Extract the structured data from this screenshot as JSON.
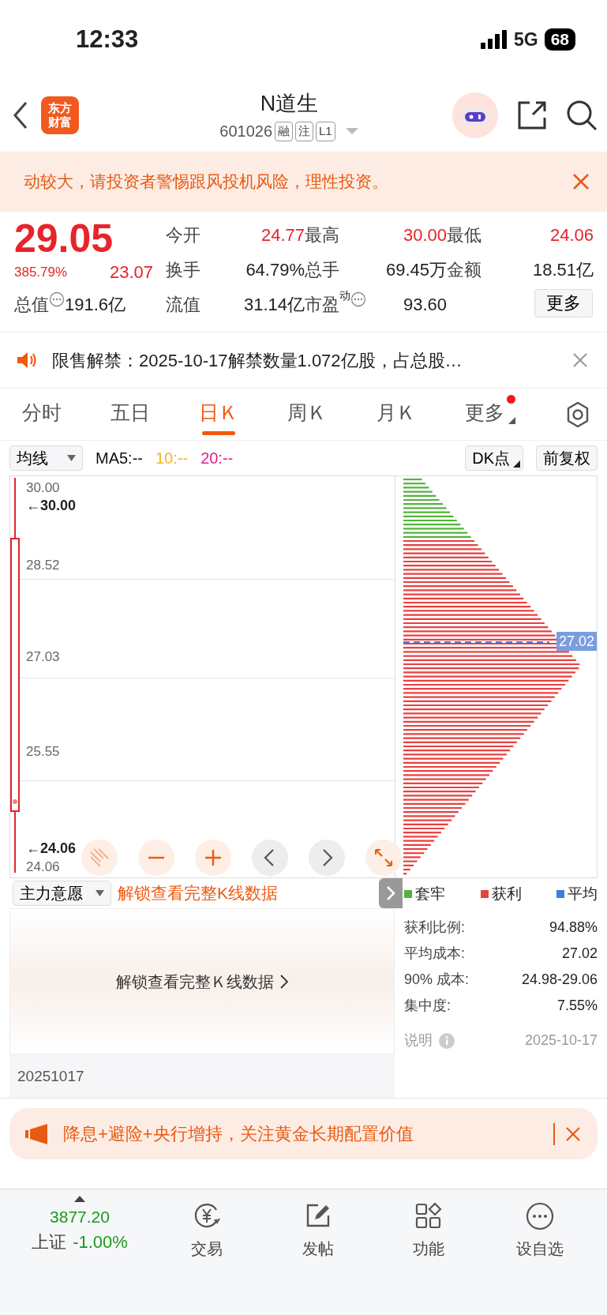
{
  "status_bar": {
    "time": "12:33",
    "network": "5G",
    "battery": "68"
  },
  "header": {
    "logo": "东方财富",
    "title": "N道生",
    "code": "601026",
    "tags": [
      "融",
      "注",
      "L1"
    ]
  },
  "warning": {
    "text": "动较大，请投资者警惕跟风投机风险，理性投资。"
  },
  "quote": {
    "price": "29.05",
    "change_pct": "385.79%",
    "change": "23.07",
    "fields": [
      {
        "label": "今开",
        "value": "24.77",
        "kind": "up",
        "info": false
      },
      {
        "label": "最高",
        "value": "30.00",
        "kind": "up",
        "info": false
      },
      {
        "label": "最低",
        "value": "24.06",
        "kind": "up",
        "info": false
      },
      {
        "label": "换手",
        "value": "64.79%",
        "kind": "plain",
        "info": false
      },
      {
        "label": "总手",
        "value": "69.45万",
        "kind": "plain",
        "info": false
      },
      {
        "label": "金额",
        "value": "18.51亿",
        "kind": "plain",
        "info": false
      },
      {
        "label": "总值",
        "value": "191.6亿",
        "kind": "plain",
        "info": true
      },
      {
        "label": "流值",
        "value": "31.14亿",
        "kind": "plain",
        "info": false
      },
      {
        "label": "市盈",
        "sup": "动",
        "value": "93.60",
        "kind": "plain",
        "info": true
      }
    ],
    "more_button": "更多"
  },
  "notice": {
    "text": "限售解禁：2025-10-17解禁数量1.072亿股，占总股…"
  },
  "tabs": [
    {
      "label": "分时",
      "selected": false,
      "dot": false
    },
    {
      "label": "五日",
      "selected": false,
      "dot": false
    },
    {
      "label": "日Ｋ",
      "selected": true,
      "dot": false
    },
    {
      "label": "周Ｋ",
      "selected": false,
      "dot": false
    },
    {
      "label": "月Ｋ",
      "selected": false,
      "dot": false
    },
    {
      "label": "更多",
      "selected": false,
      "dot": true
    }
  ],
  "chart_toolbar": {
    "indicator": "均线",
    "ma": [
      {
        "label": "MA5:--",
        "color": "#111111"
      },
      {
        "label": "10:--",
        "color": "#f5b325"
      },
      {
        "label": "20:--",
        "color": "#e0208a"
      }
    ],
    "dk_button": "DK点",
    "adjust_button": "前复权"
  },
  "kline": {
    "axis_labels": [
      "30.00",
      "28.52",
      "27.03",
      "25.55",
      "24.06"
    ],
    "high_marker": "←30.00",
    "low_marker": "←24.06"
  },
  "chips": {
    "avg_label": "27.02"
  },
  "sub_toolbar": {
    "indicator": "主力意愿",
    "unlock_link": "解锁查看完整K线数据"
  },
  "locked": {
    "text": "解锁查看完整Ｋ线数据",
    "date": "20251017"
  },
  "legend": [
    {
      "label": "套牢",
      "color": "#52b43c"
    },
    {
      "label": "获利",
      "color": "#e8403f"
    },
    {
      "label": "平均",
      "color": "#3b7fe0"
    }
  ],
  "stats": [
    {
      "label": "获利比例:",
      "value": "94.88%"
    },
    {
      "label": "平均成本:",
      "value": "27.02"
    },
    {
      "label": "90% 成本:",
      "value": "24.98-29.06"
    },
    {
      "label": "集中度:",
      "value": "7.55%"
    }
  ],
  "stats_footer": {
    "label": "说明",
    "date": "2025-10-17"
  },
  "ad": {
    "text": "降息+避险+央行增持，关注黄金长期配置价值"
  },
  "bottom_nav": {
    "index_value": "3877.20",
    "index_name": "上证",
    "index_change": "-1.00%",
    "items": [
      {
        "label": "交易",
        "kind": "trade"
      },
      {
        "label": "发帖",
        "kind": "post"
      },
      {
        "label": "功能",
        "kind": "apps"
      },
      {
        "label": "设自选",
        "kind": "more"
      }
    ]
  }
}
